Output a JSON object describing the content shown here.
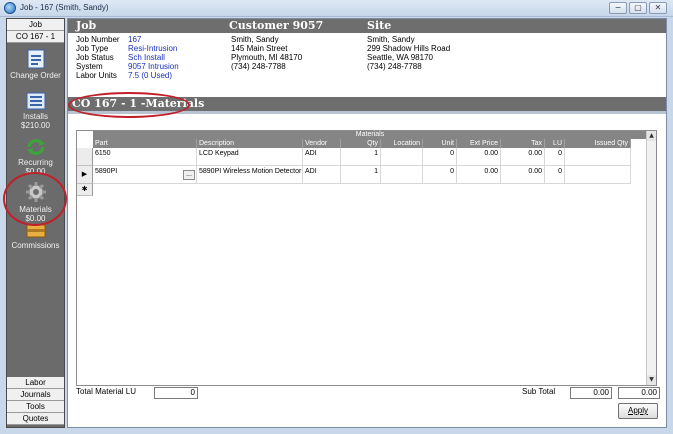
{
  "window": {
    "title": "Job - 167 (Smith, Sandy)",
    "buttons": [
      "−",
      "▢",
      "✕"
    ]
  },
  "sidebar": {
    "top_tabs": [
      "Job",
      "CO 167 - 1"
    ],
    "items": [
      {
        "label": "Change Order",
        "sub": "",
        "icon": "document-icon"
      },
      {
        "label": "Installs",
        "sub": "$210.00",
        "icon": "list-icon"
      },
      {
        "label": "Recurring",
        "sub": "$0.00",
        "icon": "recycle-icon"
      },
      {
        "label": "Materials",
        "sub": "$0.00",
        "icon": "gear-icon"
      },
      {
        "label": "Commissions",
        "sub": "",
        "icon": "money-icon"
      }
    ],
    "bottom_tabs": [
      "Labor",
      "Journals",
      "Tools",
      "Quotes"
    ]
  },
  "header": {
    "job": "Job",
    "customer": "Customer 9057",
    "site": "Site"
  },
  "job_info": [
    {
      "label": "Job Number",
      "value": "167"
    },
    {
      "label": "Job Type",
      "value": "Resi-Intrusion"
    },
    {
      "label": "Job Status",
      "value": "Sch Install"
    },
    {
      "label": "System",
      "value": "9057 Intrusion"
    },
    {
      "label": "Labor Units",
      "value": "7.5 (0 Used)"
    }
  ],
  "customer_info": [
    "Smith, Sandy",
    "145 Main Street",
    "Plymouth, MI  48170",
    "(734) 248-7788"
  ],
  "site_info": [
    "Smith, Sandy",
    "299 Shadow Hills Road",
    "Seattle, WA  98170",
    "(734) 248-7788"
  ],
  "section_title": "CO 167 - 1 -Materials",
  "grid": {
    "caption": "Materials",
    "columns": [
      "Part",
      "Description",
      "Vendor",
      "Qty",
      "Location",
      "Unit",
      "Ext Price",
      "Tax",
      "LU",
      "Issued Qty"
    ],
    "rows": [
      {
        "part": "6150",
        "description": "LCD Keypad",
        "vendor": "ADI",
        "qty": "1",
        "location": "",
        "unit": "0",
        "ext_price": "0.00",
        "tax": "0.00",
        "lu": "0",
        "issued": ""
      },
      {
        "part": "5890PI",
        "description": "5890PI Wireless Motion Detector",
        "vendor": "ADI",
        "qty": "1",
        "location": "",
        "unit": "0",
        "ext_price": "0.00",
        "tax": "0.00",
        "lu": "0",
        "issued": ""
      }
    ],
    "row_markers": [
      "",
      "▶",
      "✱"
    ],
    "ellipsis": "..."
  },
  "footer": {
    "total_lu_label": "Total Material LU",
    "total_lu_value": "0",
    "subtotal_label": "Sub Total",
    "subtotal_value": "0.00",
    "subtotal_value2": "0.00",
    "apply_label": "Apply"
  },
  "colors": {
    "annotation": "#c0202a",
    "link_blue": "#1a2fbf",
    "header_gray": "#6e6e6e"
  }
}
